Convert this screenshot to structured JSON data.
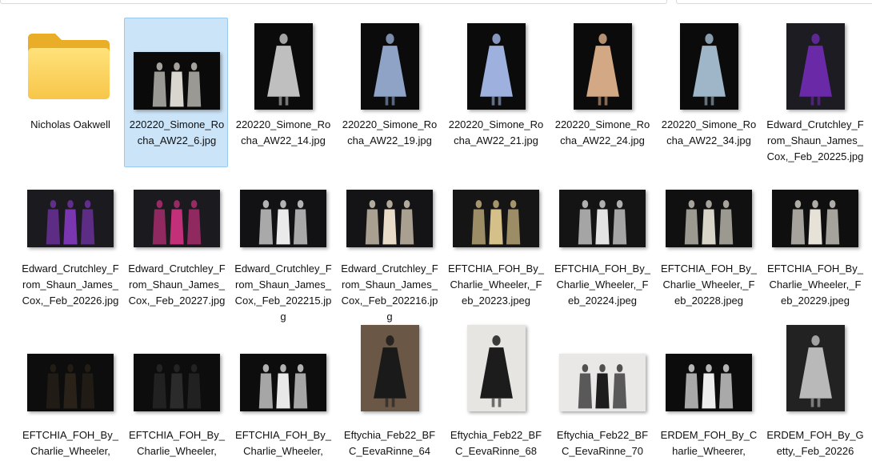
{
  "window": {
    "title": "Nicholas Oakwell"
  },
  "items": [
    {
      "name": "Nicholas Oakwell",
      "kind": "folder",
      "icon": "folder-icon"
    },
    {
      "name": "220220_Simone_Rocha_AW22_6.jpg",
      "kind": "landscape",
      "selected": true,
      "colors": [
        "#0a0a0a",
        "#d9d5cf"
      ]
    },
    {
      "name": "220220_Simone_Rocha_AW22_14.jpg",
      "kind": "portrait",
      "colors": [
        "#0b0b0b",
        "#bfbfbf"
      ]
    },
    {
      "name": "220220_Simone_Rocha_AW22_19.jpg",
      "kind": "portrait",
      "colors": [
        "#0b0b0b",
        "#8fa3c7"
      ]
    },
    {
      "name": "220220_Simone_Rocha_AW22_21.jpg",
      "kind": "portrait",
      "colors": [
        "#0b0b0b",
        "#9eb1de"
      ]
    },
    {
      "name": "220220_Simone_Rocha_AW22_24.jpg",
      "kind": "portrait",
      "colors": [
        "#0b0b0b",
        "#d3a885"
      ]
    },
    {
      "name": "220220_Simone_Rocha_AW22_34.jpg",
      "kind": "portrait",
      "colors": [
        "#0b0b0b",
        "#9fb6c8"
      ]
    },
    {
      "name": "Edward_Crutchley_From_Shaun_James_Cox,_Feb_20225.jpg",
      "kind": "portrait",
      "colors": [
        "#1c1c22",
        "#6a2aa8"
      ]
    },
    {
      "name": "Edward_Crutchley_From_Shaun_James_Cox,_Feb_20226.jpg",
      "kind": "landscape",
      "colors": [
        "#1a1a1f",
        "#7a36b0"
      ]
    },
    {
      "name": "Edward_Crutchley_From_Shaun_James_Cox,_Feb_20227.jpg",
      "kind": "landscape",
      "colors": [
        "#1a1a1f",
        "#c2307a"
      ]
    },
    {
      "name": "Edward_Crutchley_From_Shaun_James_Cox,_Feb_202215.jpg",
      "kind": "landscape",
      "colors": [
        "#121214",
        "#eaeaea"
      ]
    },
    {
      "name": "Edward_Crutchley_From_Shaun_James_Cox,_Feb_202216.jpg",
      "kind": "landscape",
      "colors": [
        "#141416",
        "#e8dcc8"
      ]
    },
    {
      "name": "EFTCHIA_FOH_By_Charlie_Wheeler,_Feb_20223.jpeg",
      "kind": "landscape",
      "colors": [
        "#151515",
        "#d6c08a"
      ]
    },
    {
      "name": "EFTCHIA_FOH_By_Charlie_Wheeler,_Feb_20224.jpeg",
      "kind": "landscape",
      "colors": [
        "#141414",
        "#e3e3e3"
      ]
    },
    {
      "name": "EFTCHIA_FOH_By_Charlie_Wheeler,_Feb_20228.jpeg",
      "kind": "landscape",
      "colors": [
        "#101010",
        "#d9d4c8"
      ]
    },
    {
      "name": "EFTCHIA_FOH_By_Charlie_Wheeler,_Feb_20229.jpeg",
      "kind": "landscape",
      "colors": [
        "#0f0f0f",
        "#e6e2d8"
      ]
    },
    {
      "name": "EFTCHIA_FOH_By_Charlie_Wheeler,",
      "kind": "landscape",
      "colors": [
        "#0d0d0d",
        "#2a2218"
      ]
    },
    {
      "name": "EFTCHIA_FOH_By_Charlie_Wheeler,",
      "kind": "landscape",
      "colors": [
        "#0d0d0d",
        "#2b2b2b"
      ]
    },
    {
      "name": "EFTCHIA_FOH_By_Charlie_Wheeler,",
      "kind": "landscape",
      "colors": [
        "#0d0d0d",
        "#e8e8e8"
      ]
    },
    {
      "name": "Eftychia_Feb22_BFC_EevaRinne_64",
      "kind": "portrait",
      "colors": [
        "#6b5746",
        "#1a1a1a"
      ]
    },
    {
      "name": "Eftychia_Feb22_BFC_EevaRinne_68",
      "kind": "portrait",
      "colors": [
        "#e7e5e2",
        "#1c1c1c"
      ]
    },
    {
      "name": "Eftychia_Feb22_BFC_EevaRinne_70",
      "kind": "landscape",
      "colors": [
        "#e9e8e6",
        "#1d1d1d"
      ]
    },
    {
      "name": "ERDEM_FOH_By_Charlie_Wheerer,",
      "kind": "landscape",
      "colors": [
        "#0c0c0c",
        "#ededed"
      ]
    },
    {
      "name": "ERDEM_FOH_By_Getty,_Feb_20226",
      "kind": "portrait",
      "colors": [
        "#222",
        "#b9b9b9"
      ]
    }
  ]
}
